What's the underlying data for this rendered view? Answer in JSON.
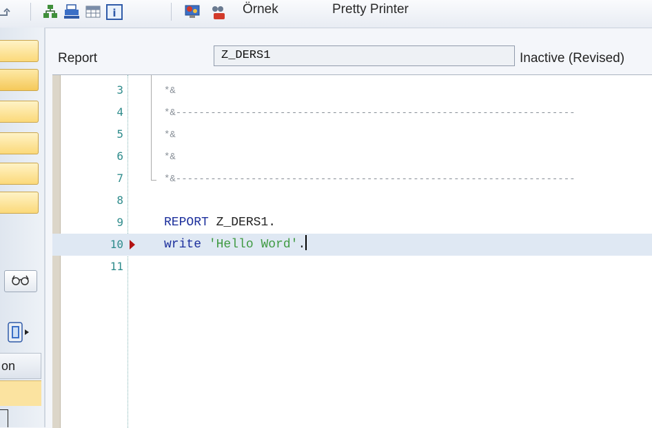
{
  "toolbar": {
    "items": [
      {
        "label": "Örnek"
      },
      {
        "label": "Pretty Printer"
      }
    ],
    "icons": [
      "return-arrow-icon",
      "hierarchy-icon",
      "printer-icon",
      "table-icon",
      "info-icon",
      "test-monitor-icon",
      "users-stop-icon"
    ]
  },
  "sidebar": {
    "partial_label": "on",
    "icons": [
      "glasses-icon",
      "expand-panel-icon"
    ]
  },
  "header": {
    "object_type_label": "Report",
    "program_name": "Z_DERS1",
    "status": "Inactive (Revised)"
  },
  "editor": {
    "current_line": 10,
    "lines": [
      {
        "num": "3",
        "parts": [
          {
            "t": "*&",
            "c": "comment"
          }
        ]
      },
      {
        "num": "4",
        "parts": [
          {
            "t": "*&---------------------------------------------------------------------",
            "c": "comment"
          }
        ]
      },
      {
        "num": "5",
        "parts": [
          {
            "t": "*&",
            "c": "comment"
          }
        ]
      },
      {
        "num": "6",
        "parts": [
          {
            "t": "*&",
            "c": "comment"
          }
        ]
      },
      {
        "num": "7",
        "parts": [
          {
            "t": "*&---------------------------------------------------------------------",
            "c": "comment"
          }
        ]
      },
      {
        "num": "8",
        "parts": []
      },
      {
        "num": "9",
        "parts": [
          {
            "t": "REPORT",
            "c": "kw"
          },
          {
            "t": " Z_DERS1.",
            "c": "plain"
          }
        ]
      },
      {
        "num": "10",
        "parts": [
          {
            "t": "write",
            "c": "kw"
          },
          {
            "t": " ",
            "c": "plain"
          },
          {
            "t": "'Hello Word'",
            "c": "str"
          },
          {
            "t": ".",
            "c": "plain"
          }
        ]
      },
      {
        "num": "11",
        "parts": []
      }
    ]
  },
  "colors": {
    "keyword": "#1c2f9c",
    "string": "#3f9a42",
    "comment": "#8a9199",
    "line_number": "#2f8c8c",
    "breakpoint_marker": "#b21212",
    "current_line_bg": "#dfe8f3"
  }
}
